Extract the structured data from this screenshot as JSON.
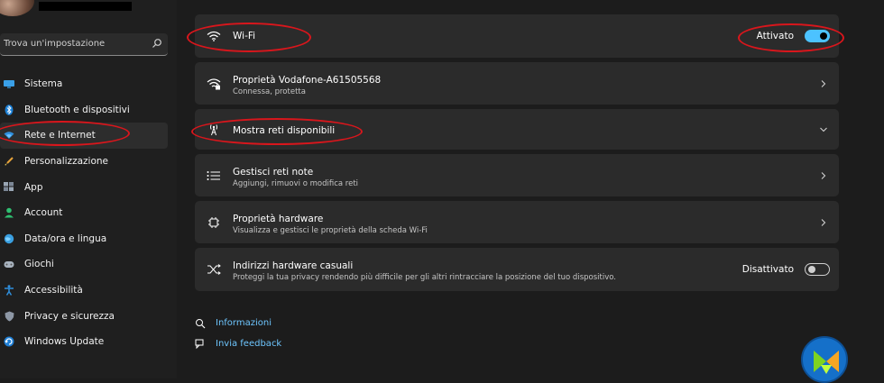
{
  "search": {
    "placeholder": "Trova un'impostazione"
  },
  "sidebar": {
    "items": [
      {
        "label": "Sistema",
        "icon": "monitor-icon"
      },
      {
        "label": "Bluetooth e dispositivi",
        "icon": "bluetooth-icon"
      },
      {
        "label": "Rete e Internet",
        "icon": "network-icon",
        "active": true
      },
      {
        "label": "Personalizzazione",
        "icon": "brush-icon"
      },
      {
        "label": "App",
        "icon": "apps-icon"
      },
      {
        "label": "Account",
        "icon": "person-icon"
      },
      {
        "label": "Data/ora e lingua",
        "icon": "globe-clock-icon"
      },
      {
        "label": "Giochi",
        "icon": "gamepad-icon"
      },
      {
        "label": "Accessibilità",
        "icon": "accessibility-icon"
      },
      {
        "label": "Privacy e sicurezza",
        "icon": "shield-icon"
      },
      {
        "label": "Windows Update",
        "icon": "update-icon"
      }
    ]
  },
  "main": {
    "wifi": {
      "title": "Wi-Fi",
      "toggle_label": "Attivato",
      "toggle_on": true
    },
    "properties": {
      "title": "Proprietà Vodafone-A61505568",
      "subtitle": "Connessa, protetta"
    },
    "available": {
      "title": "Mostra reti disponibili"
    },
    "known": {
      "title": "Gestisci reti note",
      "subtitle": "Aggiungi, rimuovi o modifica reti"
    },
    "hardware": {
      "title": "Proprietà hardware",
      "subtitle": "Visualizza e gestisci le proprietà della scheda Wi-Fi"
    },
    "random": {
      "title": "Indirizzi hardware casuali",
      "subtitle": "Proteggi la tua privacy rendendo più difficile per gli altri rintracciare la posizione del tuo dispositivo.",
      "toggle_label": "Disattivato",
      "toggle_on": false
    }
  },
  "footer": {
    "info": "Informazioni",
    "feedback": "Invia feedback"
  },
  "colors": {
    "accent": "#4cc2ff",
    "annotation": "#d9161c",
    "link": "#6ec6ff",
    "card": "#2b2b2b",
    "background": "#1c1c1c"
  }
}
